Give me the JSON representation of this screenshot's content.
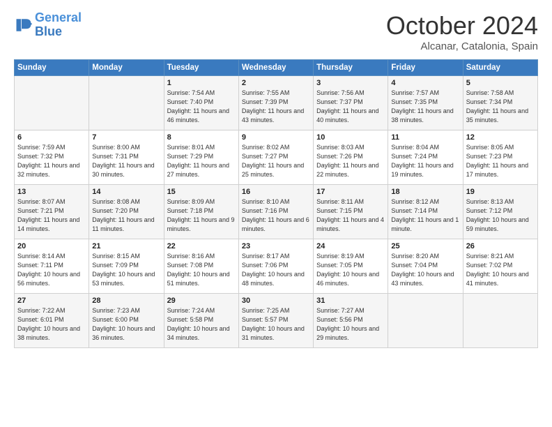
{
  "logo": {
    "line1": "General",
    "line2": "Blue"
  },
  "header": {
    "month": "October 2024",
    "location": "Alcanar, Catalonia, Spain"
  },
  "weekdays": [
    "Sunday",
    "Monday",
    "Tuesday",
    "Wednesday",
    "Thursday",
    "Friday",
    "Saturday"
  ],
  "weeks": [
    [
      {
        "day": "",
        "sunrise": "",
        "sunset": "",
        "daylight": ""
      },
      {
        "day": "",
        "sunrise": "",
        "sunset": "",
        "daylight": ""
      },
      {
        "day": "1",
        "sunrise": "Sunrise: 7:54 AM",
        "sunset": "Sunset: 7:40 PM",
        "daylight": "Daylight: 11 hours and 46 minutes."
      },
      {
        "day": "2",
        "sunrise": "Sunrise: 7:55 AM",
        "sunset": "Sunset: 7:39 PM",
        "daylight": "Daylight: 11 hours and 43 minutes."
      },
      {
        "day": "3",
        "sunrise": "Sunrise: 7:56 AM",
        "sunset": "Sunset: 7:37 PM",
        "daylight": "Daylight: 11 hours and 40 minutes."
      },
      {
        "day": "4",
        "sunrise": "Sunrise: 7:57 AM",
        "sunset": "Sunset: 7:35 PM",
        "daylight": "Daylight: 11 hours and 38 minutes."
      },
      {
        "day": "5",
        "sunrise": "Sunrise: 7:58 AM",
        "sunset": "Sunset: 7:34 PM",
        "daylight": "Daylight: 11 hours and 35 minutes."
      }
    ],
    [
      {
        "day": "6",
        "sunrise": "Sunrise: 7:59 AM",
        "sunset": "Sunset: 7:32 PM",
        "daylight": "Daylight: 11 hours and 32 minutes."
      },
      {
        "day": "7",
        "sunrise": "Sunrise: 8:00 AM",
        "sunset": "Sunset: 7:31 PM",
        "daylight": "Daylight: 11 hours and 30 minutes."
      },
      {
        "day": "8",
        "sunrise": "Sunrise: 8:01 AM",
        "sunset": "Sunset: 7:29 PM",
        "daylight": "Daylight: 11 hours and 27 minutes."
      },
      {
        "day": "9",
        "sunrise": "Sunrise: 8:02 AM",
        "sunset": "Sunset: 7:27 PM",
        "daylight": "Daylight: 11 hours and 25 minutes."
      },
      {
        "day": "10",
        "sunrise": "Sunrise: 8:03 AM",
        "sunset": "Sunset: 7:26 PM",
        "daylight": "Daylight: 11 hours and 22 minutes."
      },
      {
        "day": "11",
        "sunrise": "Sunrise: 8:04 AM",
        "sunset": "Sunset: 7:24 PM",
        "daylight": "Daylight: 11 hours and 19 minutes."
      },
      {
        "day": "12",
        "sunrise": "Sunrise: 8:05 AM",
        "sunset": "Sunset: 7:23 PM",
        "daylight": "Daylight: 11 hours and 17 minutes."
      }
    ],
    [
      {
        "day": "13",
        "sunrise": "Sunrise: 8:07 AM",
        "sunset": "Sunset: 7:21 PM",
        "daylight": "Daylight: 11 hours and 14 minutes."
      },
      {
        "day": "14",
        "sunrise": "Sunrise: 8:08 AM",
        "sunset": "Sunset: 7:20 PM",
        "daylight": "Daylight: 11 hours and 11 minutes."
      },
      {
        "day": "15",
        "sunrise": "Sunrise: 8:09 AM",
        "sunset": "Sunset: 7:18 PM",
        "daylight": "Daylight: 11 hours and 9 minutes."
      },
      {
        "day": "16",
        "sunrise": "Sunrise: 8:10 AM",
        "sunset": "Sunset: 7:16 PM",
        "daylight": "Daylight: 11 hours and 6 minutes."
      },
      {
        "day": "17",
        "sunrise": "Sunrise: 8:11 AM",
        "sunset": "Sunset: 7:15 PM",
        "daylight": "Daylight: 11 hours and 4 minutes."
      },
      {
        "day": "18",
        "sunrise": "Sunrise: 8:12 AM",
        "sunset": "Sunset: 7:14 PM",
        "daylight": "Daylight: 11 hours and 1 minute."
      },
      {
        "day": "19",
        "sunrise": "Sunrise: 8:13 AM",
        "sunset": "Sunset: 7:12 PM",
        "daylight": "Daylight: 10 hours and 59 minutes."
      }
    ],
    [
      {
        "day": "20",
        "sunrise": "Sunrise: 8:14 AM",
        "sunset": "Sunset: 7:11 PM",
        "daylight": "Daylight: 10 hours and 56 minutes."
      },
      {
        "day": "21",
        "sunrise": "Sunrise: 8:15 AM",
        "sunset": "Sunset: 7:09 PM",
        "daylight": "Daylight: 10 hours and 53 minutes."
      },
      {
        "day": "22",
        "sunrise": "Sunrise: 8:16 AM",
        "sunset": "Sunset: 7:08 PM",
        "daylight": "Daylight: 10 hours and 51 minutes."
      },
      {
        "day": "23",
        "sunrise": "Sunrise: 8:17 AM",
        "sunset": "Sunset: 7:06 PM",
        "daylight": "Daylight: 10 hours and 48 minutes."
      },
      {
        "day": "24",
        "sunrise": "Sunrise: 8:19 AM",
        "sunset": "Sunset: 7:05 PM",
        "daylight": "Daylight: 10 hours and 46 minutes."
      },
      {
        "day": "25",
        "sunrise": "Sunrise: 8:20 AM",
        "sunset": "Sunset: 7:04 PM",
        "daylight": "Daylight: 10 hours and 43 minutes."
      },
      {
        "day": "26",
        "sunrise": "Sunrise: 8:21 AM",
        "sunset": "Sunset: 7:02 PM",
        "daylight": "Daylight: 10 hours and 41 minutes."
      }
    ],
    [
      {
        "day": "27",
        "sunrise": "Sunrise: 7:22 AM",
        "sunset": "Sunset: 6:01 PM",
        "daylight": "Daylight: 10 hours and 38 minutes."
      },
      {
        "day": "28",
        "sunrise": "Sunrise: 7:23 AM",
        "sunset": "Sunset: 6:00 PM",
        "daylight": "Daylight: 10 hours and 36 minutes."
      },
      {
        "day": "29",
        "sunrise": "Sunrise: 7:24 AM",
        "sunset": "Sunset: 5:58 PM",
        "daylight": "Daylight: 10 hours and 34 minutes."
      },
      {
        "day": "30",
        "sunrise": "Sunrise: 7:25 AM",
        "sunset": "Sunset: 5:57 PM",
        "daylight": "Daylight: 10 hours and 31 minutes."
      },
      {
        "day": "31",
        "sunrise": "Sunrise: 7:27 AM",
        "sunset": "Sunset: 5:56 PM",
        "daylight": "Daylight: 10 hours and 29 minutes."
      },
      {
        "day": "",
        "sunrise": "",
        "sunset": "",
        "daylight": ""
      },
      {
        "day": "",
        "sunrise": "",
        "sunset": "",
        "daylight": ""
      }
    ]
  ]
}
